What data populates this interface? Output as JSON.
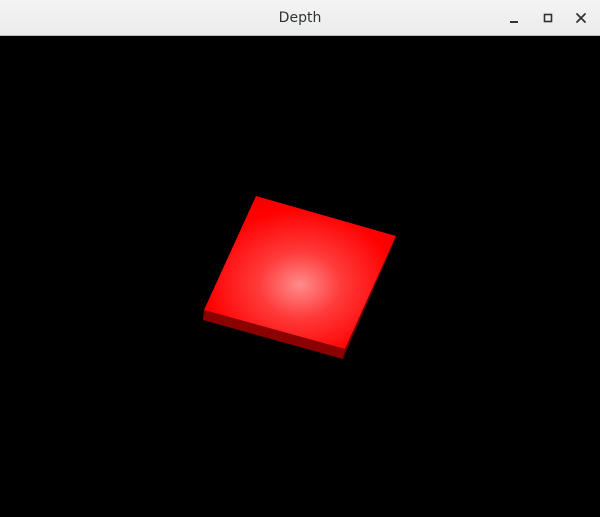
{
  "window": {
    "title": "Depth"
  },
  "controls": {
    "minimize_icon": "minimize-icon",
    "maximize_icon": "maximize-icon",
    "close_icon": "close-icon"
  },
  "scene": {
    "background_color": "#000000",
    "object": {
      "shape": "flat box",
      "top_face_color": "#ff0000",
      "highlight_color": "#ff8c8c",
      "side_face_color": "#8b0000"
    }
  }
}
